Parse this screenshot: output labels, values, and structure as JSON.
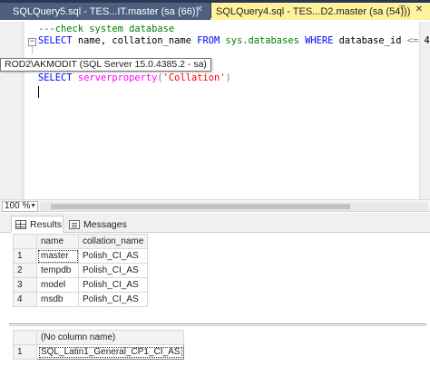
{
  "tabs": [
    {
      "label": "SQLQuery5.sql - TES...IT.master (sa (66))",
      "close": "✕"
    },
    {
      "label": "SQLQuery4.sql - TES...D2.master (sa (54)))",
      "pin": "⊤",
      "close": "✕"
    }
  ],
  "editor": {
    "comment_line": "---check system database",
    "line1": {
      "kw_select": "SELECT",
      "cols": "name, collation_name",
      "kw_from": "FROM",
      "table": "sys.databases",
      "kw_where": "WHERE",
      "col": "database_id",
      "op": "<=",
      "val": "4"
    },
    "line2": {
      "kw_select": "SELECT",
      "fn": "serverproperty",
      "paren_open": "(",
      "str": "'Collation'",
      "paren_close": ")"
    },
    "tooltip": "ROD2\\AKMODIT (SQL Server 15.0.4385.2 - sa)"
  },
  "zoom": {
    "value": "100 %"
  },
  "results_tabs": {
    "results": "Results",
    "messages": "Messages"
  },
  "grid1": {
    "headers": [
      "name",
      "collation_name"
    ],
    "rows": [
      {
        "n": "1",
        "name": "master",
        "collation": "Polish_CI_AS"
      },
      {
        "n": "2",
        "name": "tempdb",
        "collation": "Polish_CI_AS"
      },
      {
        "n": "3",
        "name": "model",
        "collation": "Polish_CI_AS"
      },
      {
        "n": "4",
        "name": "msdb",
        "collation": "Polish_CI_AS"
      }
    ]
  },
  "grid2": {
    "header": "(No column name)",
    "rows": [
      {
        "n": "1",
        "value": "SQL_Latin1_General_CP1_CI_AS"
      }
    ]
  },
  "colors": {
    "tab_strip": "#293955",
    "active_tab": "#fff29d",
    "keyword": "#0000ff",
    "function": "#ff00ff",
    "string": "#ff0000",
    "comment": "#008000"
  }
}
